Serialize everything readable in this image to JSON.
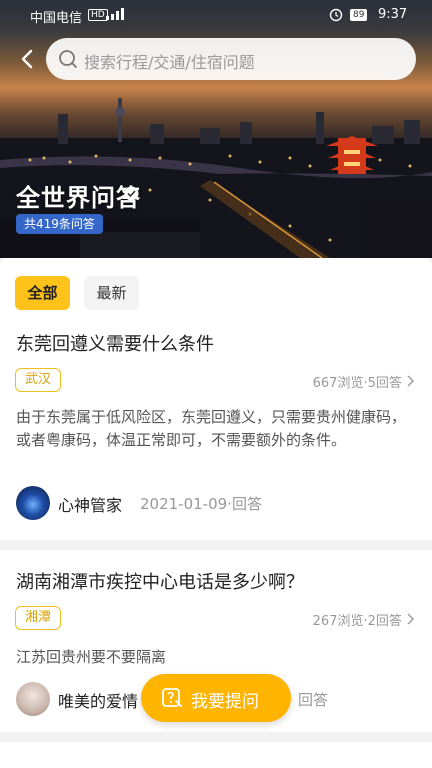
{
  "status_bar": {
    "carrier": "中国电信",
    "hd": "HD",
    "battery": "89",
    "time": "9:37"
  },
  "search": {
    "placeholder": "搜索行程/交通/住宿问题"
  },
  "hero": {
    "title": "全世界问答",
    "count_badge": "共419条问答"
  },
  "tabs": [
    {
      "label": "全部",
      "active": true
    },
    {
      "label": "最新",
      "active": false
    }
  ],
  "questions": [
    {
      "title": "东莞回遵义需要什么条件",
      "tag": "武汉",
      "meta": "667浏览·5回答",
      "answer": "由于东莞属于低风险区，东莞回遵义，只需要贵州健康码，或者粤康码，体温正常即可，不需要额外的条件。",
      "author": "心神管家",
      "date": "2021-01-09·回答"
    },
    {
      "title": "湖南湘潭市疾控中心电话是多少啊？",
      "tag": "湘潭",
      "meta": "267浏览·2回答",
      "answer": "江苏回贵州要不要隔离",
      "author": "唯美的爱情",
      "date": "回答"
    }
  ],
  "fab": {
    "label": "我要提问"
  },
  "colors": {
    "accent": "#ffc21a",
    "badge": "#3567c9",
    "fab": "#ffb400"
  }
}
